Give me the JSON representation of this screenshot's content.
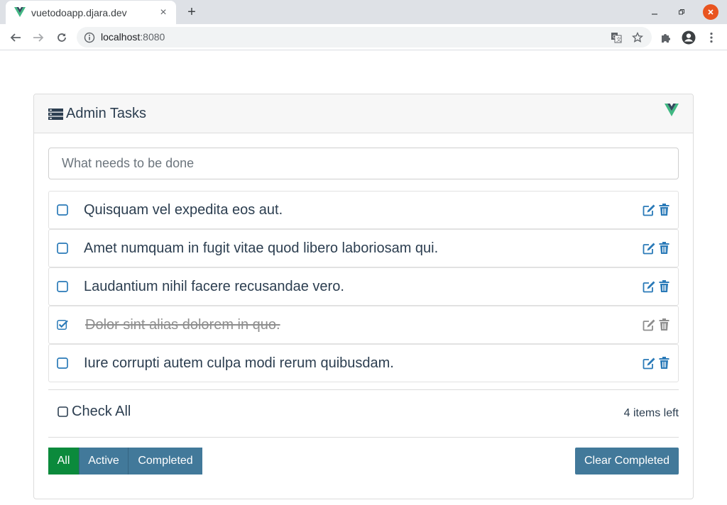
{
  "browser": {
    "tab_title": "vuetodoapp.djara.dev",
    "url_host": "localhost",
    "url_port": ":8080"
  },
  "app": {
    "title": "Admin Tasks",
    "new_todo_placeholder": "What needs to be done",
    "todos": [
      {
        "text": "Quisquam vel expedita eos aut.",
        "completed": false
      },
      {
        "text": "Amet numquam in fugit vitae quod libero laboriosam qui.",
        "completed": false
      },
      {
        "text": "Laudantium nihil facere recusandae vero.",
        "completed": false
      },
      {
        "text": "Dolor sint alias dolorem in quo.",
        "completed": true
      },
      {
        "text": "Iure corrupti autem culpa modi rerum quibusdam.",
        "completed": false
      }
    ],
    "check_all_label": "Check All",
    "items_left": "4 items left",
    "filters": [
      "All",
      "Active",
      "Completed"
    ],
    "active_filter": "All",
    "clear_completed_label": "Clear Completed"
  },
  "colors": {
    "accent_blue": "#42799a",
    "active_green": "#0b8a3c",
    "icon_blue": "#2a7ab8",
    "icon_disabled": "#8e8e8e",
    "vue_green": "#41b883",
    "vue_dark": "#34495e"
  }
}
